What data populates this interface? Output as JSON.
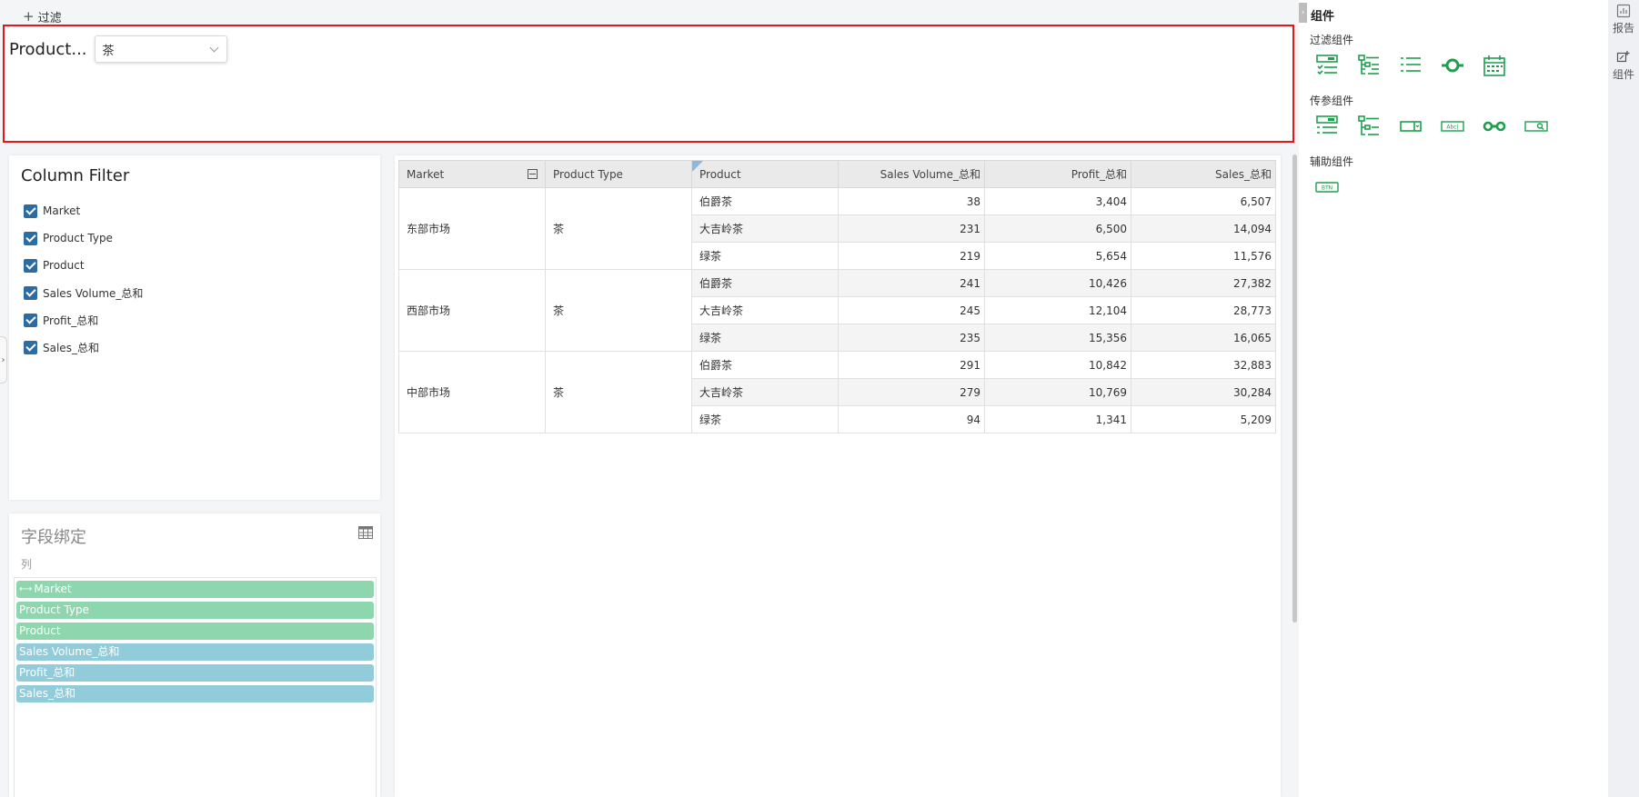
{
  "toolbar": {
    "add_filter_label": "过滤"
  },
  "filter": {
    "label": "Product...",
    "selected": "茶"
  },
  "column_filter": {
    "title": "Column Filter",
    "items": [
      "Market",
      "Product Type",
      "Product",
      "Sales Volume_总和",
      "Profit_总和",
      "Sales_总和"
    ]
  },
  "field_binding": {
    "title": "字段绑定",
    "section": "列",
    "dimensions": [
      "Market",
      "Product Type",
      "Product"
    ],
    "measures": [
      "Sales Volume_总和",
      "Profit_总和",
      "Sales_总和"
    ]
  },
  "table": {
    "headers": [
      "Market",
      "Product Type",
      "Product",
      "Sales Volume_总和",
      "Profit_总和",
      "Sales_总和"
    ],
    "groups": [
      {
        "market": "东部市场",
        "type": "茶",
        "rows": [
          {
            "product": "伯爵茶",
            "volume": "38",
            "profit": "3,404",
            "sales": "6,507"
          },
          {
            "product": "大吉岭茶",
            "volume": "231",
            "profit": "6,500",
            "sales": "14,094"
          },
          {
            "product": "绿茶",
            "volume": "219",
            "profit": "5,654",
            "sales": "11,576"
          }
        ]
      },
      {
        "market": "西部市场",
        "type": "茶",
        "rows": [
          {
            "product": "伯爵茶",
            "volume": "241",
            "profit": "10,426",
            "sales": "27,382"
          },
          {
            "product": "大吉岭茶",
            "volume": "245",
            "profit": "12,104",
            "sales": "28,773"
          },
          {
            "product": "绿茶",
            "volume": "235",
            "profit": "15,356",
            "sales": "16,065"
          }
        ]
      },
      {
        "market": "中部市场",
        "type": "茶",
        "rows": [
          {
            "product": "伯爵茶",
            "volume": "291",
            "profit": "10,842",
            "sales": "32,883"
          },
          {
            "product": "大吉岭茶",
            "volume": "279",
            "profit": "10,769",
            "sales": "30,284"
          },
          {
            "product": "绿茶",
            "volume": "94",
            "profit": "1,341",
            "sales": "5,209"
          }
        ]
      }
    ]
  },
  "components": {
    "title": "组件",
    "filter_section": "过滤组件",
    "param_section": "传参组件",
    "aux_section": "辅助组件",
    "filter_icons": [
      "list-filter-icon",
      "tree-filter-icon",
      "checklist-filter-icon",
      "slider-filter-icon",
      "calendar-filter-icon"
    ],
    "param_icons": [
      "list-param-icon",
      "tree-param-icon",
      "dropdown-param-icon",
      "text-param-icon",
      "range-param-icon",
      "search-param-icon"
    ],
    "aux_icons": [
      "button-icon"
    ],
    "text_param_icon_text": "Abc|",
    "button_icon_text": "BTN"
  },
  "sidebar": {
    "report_label": "报告",
    "component_label": "组件"
  },
  "colors": {
    "brand_green": "#1f9e4f",
    "checkbox_blue": "#2d6ca3",
    "filter_border": "#e8151b",
    "dim_pill": "#8ed6ad",
    "measure_pill": "#92cbd9"
  }
}
